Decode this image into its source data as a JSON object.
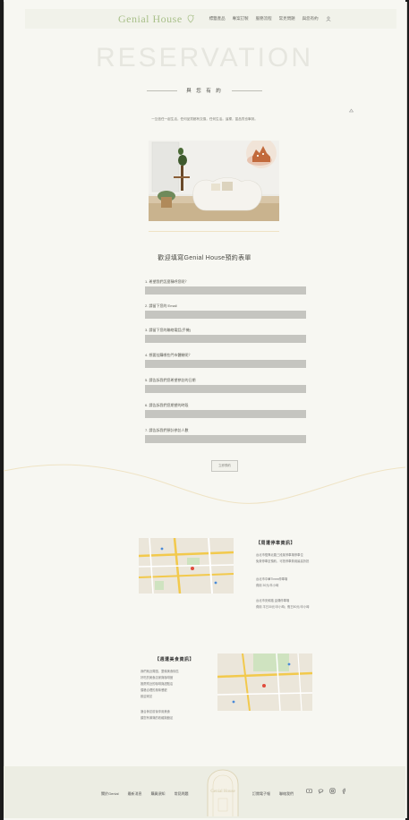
{
  "header": {
    "logo": "Genial House",
    "nav": [
      "標籤產品",
      "專案訂製",
      "服務流程",
      "常見問題",
      "與您有約"
    ]
  },
  "hero": {
    "title": "RESERVATION",
    "subtitle": "與 您 有 約",
    "description": "一互信任一起生活，任何品質都有交換，任何生活。這樣，富品質也寧到。"
  },
  "form": {
    "title": "歡迎填寫Genial House預約表單",
    "questions": [
      "1. 希望我們怎麼稱呼您呢？",
      "2. 請留下您的 Email",
      "3. 請留下您的聯絡電話(手機)",
      "4. 想要挂購哪些門市體驗呢？",
      "5. 請告訴我們您希望參訪的日期",
      "6. 請告訴我們您期望的時段",
      "7. 請告訴我們預計參訪人數"
    ],
    "submit": "立即預約"
  },
  "info1": {
    "title": "【周遭停車資訊】",
    "lines": [
      "台北市復興北路三段某停車場停車位",
      "免費停車至預約，可抵停車費用最高折抵",
      "",
      "台北市中華Times停車場",
      "費用 30元/半小時",
      "",
      "台北市安和路 遠傳停車場",
      "費用 平日30元/半小時；假日50元/半小時"
    ]
  },
  "info2": {
    "title": "【週遭美食資訊】",
    "lines": [
      "我們就近周圍，整條美食街區",
      "好吃的美食店家與咖啡館",
      "推薦附近的咖啡與甜點店",
      "價格合理的風味餐廳",
      "歡迎來訪",
      "",
      "適合參訪前後享用美食",
      "讓您有滿滿的收穫與飽足"
    ]
  },
  "footer": {
    "left_links": [
      "關於Genial",
      "最新消息",
      "購買須知",
      "常見問題"
    ],
    "right_links": [
      "訂閱電子報",
      "聯絡我們"
    ],
    "badge": "Genial House"
  }
}
